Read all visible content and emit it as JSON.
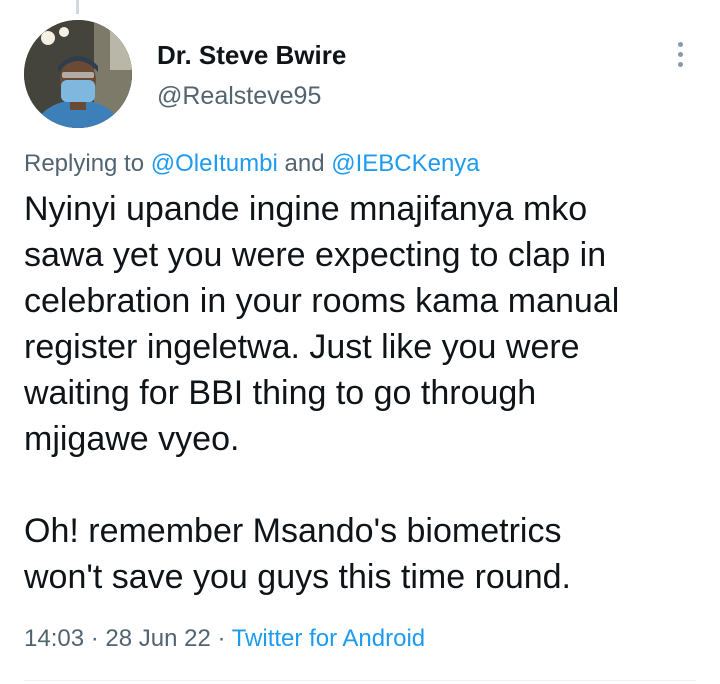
{
  "tweet": {
    "author": {
      "name": "Dr. Steve Bwire",
      "handle": "@Realsteve95"
    },
    "replying": {
      "prefix": "Replying to ",
      "mention1": "@OleItumbi",
      "joiner": " and ",
      "mention2": "@IEBCKenya"
    },
    "paragraphs": [
      "Nyinyi upande ingine mnajifanya mko\nsawa yet you were expecting to clap in\ncelebration in your rooms kama manual\nregister ingeletwa. Just like you were\nwaiting for BBI thing to go through\nmjigawe vyeo.",
      "Oh! remember Msando's biometrics\nwon't save you guys this time round."
    ],
    "meta": {
      "time": "14:03",
      "separator": " · ",
      "date": "28 Jun 22",
      "source": "Twitter for Android"
    }
  },
  "colors": {
    "text": "#0f1419",
    "secondary": "#536471",
    "accent": "#1d9bf0"
  },
  "icons": {
    "more": "more-vertical-icon"
  }
}
